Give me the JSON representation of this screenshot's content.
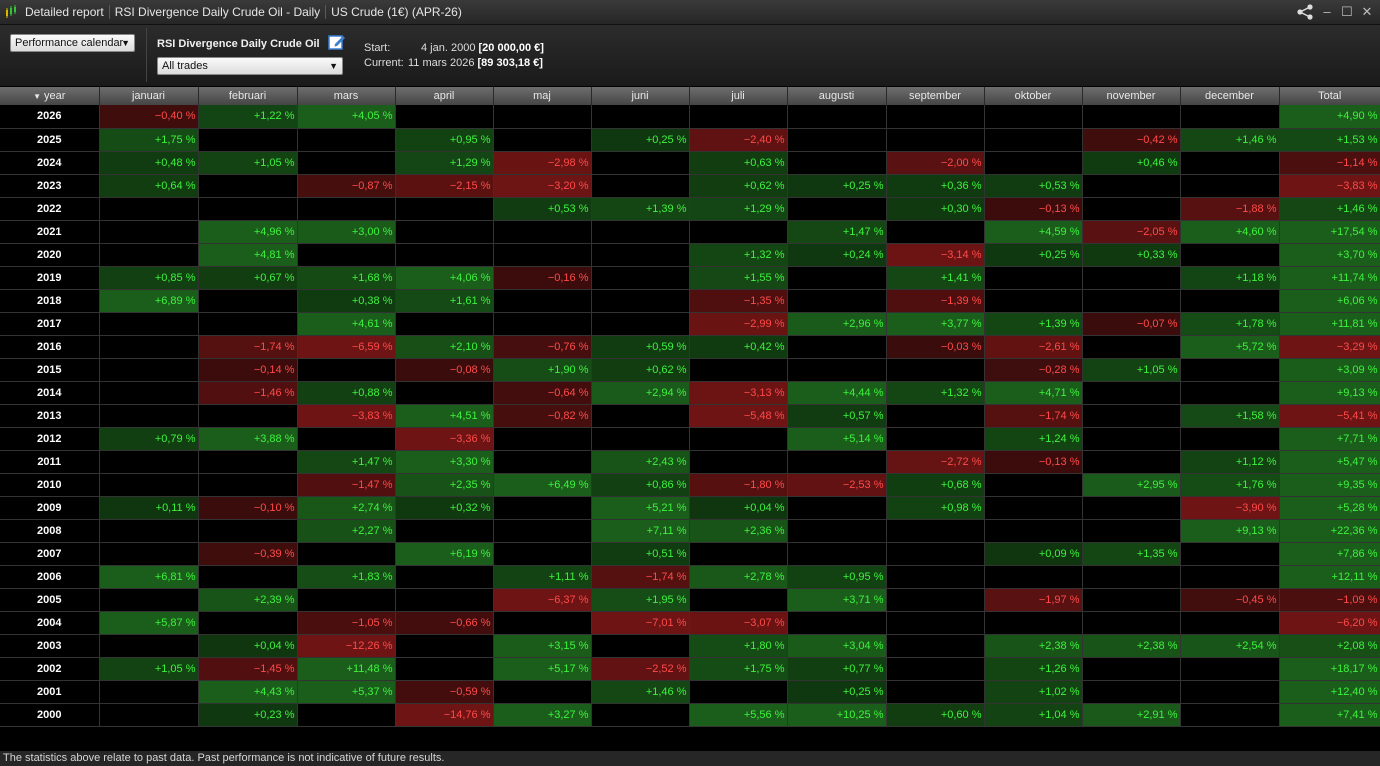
{
  "window": {
    "segments": [
      "Detailed report",
      "RSI Divergence Daily Crude Oil - Daily",
      "US Crude (1€) (APR-26)"
    ]
  },
  "controls": {
    "view_select": "Performance calendar",
    "strategy_name": "RSI Divergence Daily Crude Oil",
    "trades_select": "All trades",
    "start_label": "Start:",
    "start_date": "4 jan. 2000",
    "start_value": "[20 000,00 €]",
    "current_label": "Current:",
    "current_date": "11 mars 2026",
    "current_value": "[89 303,18 €]"
  },
  "table": {
    "sort_indicator": "▼",
    "columns": [
      "year",
      "januari",
      "februari",
      "mars",
      "april",
      "maj",
      "juni",
      "juli",
      "augusti",
      "september",
      "oktober",
      "november",
      "december",
      "Total"
    ],
    "rows": [
      [
        "2026",
        "−0,40 %",
        "+1,22 %",
        "+4,05 %",
        "",
        "",
        "",
        "",
        "",
        "",
        "",
        "",
        "",
        "+4,90 %"
      ],
      [
        "2025",
        "+1,75 %",
        "",
        "",
        "+0,95 %",
        "",
        "+0,25 %",
        "−2,40 %",
        "",
        "",
        "",
        "−0,42 %",
        "+1,46 %",
        "+1,53 %"
      ],
      [
        "2024",
        "+0,48 %",
        "+1,05 %",
        "",
        "+1,29 %",
        "−2,98 %",
        "",
        "+0,63 %",
        "",
        "−2,00 %",
        "",
        "+0,46 %",
        "",
        "−1,14 %"
      ],
      [
        "2023",
        "+0,64 %",
        "",
        "−0,87 %",
        "−2,15 %",
        "−3,20 %",
        "",
        "+0,62 %",
        "+0,25 %",
        "+0,36 %",
        "+0,53 %",
        "",
        "",
        "−3,83 %"
      ],
      [
        "2022",
        "",
        "",
        "",
        "",
        "+0,53 %",
        "+1,39 %",
        "+1,29 %",
        "",
        "+0,30 %",
        "−0,13 %",
        "",
        "−1,88 %",
        "+1,46 %"
      ],
      [
        "2021",
        "",
        "+4,96 %",
        "+3,00 %",
        "",
        "",
        "",
        "",
        "+1,47 %",
        "",
        "+4,59 %",
        "−2,05 %",
        "+4,60 %",
        "+17,54 %"
      ],
      [
        "2020",
        "",
        "+4,81 %",
        "",
        "",
        "",
        "",
        "+1,32 %",
        "+0,24 %",
        "−3,14 %",
        "+0,25 %",
        "+0,33 %",
        "",
        "+3,70 %"
      ],
      [
        "2019",
        "+0,85 %",
        "+0,67 %",
        "+1,68 %",
        "+4,06 %",
        "−0,16 %",
        "",
        "+1,55 %",
        "",
        "+1,41 %",
        "",
        "",
        "+1,18 %",
        "+11,74 %"
      ],
      [
        "2018",
        "+6,89 %",
        "",
        "+0,38 %",
        "+1,61 %",
        "",
        "",
        "−1,35 %",
        "",
        "−1,39 %",
        "",
        "",
        "",
        "+6,06 %"
      ],
      [
        "2017",
        "",
        "",
        "+4,61 %",
        "",
        "",
        "",
        "−2,99 %",
        "+2,96 %",
        "+3,77 %",
        "+1,39 %",
        "−0,07 %",
        "+1,78 %",
        "+11,81 %"
      ],
      [
        "2016",
        "",
        "−1,74 %",
        "−6,59 %",
        "+2,10 %",
        "−0,76 %",
        "+0,59 %",
        "+0,42 %",
        "",
        "−0,03 %",
        "−2,61 %",
        "",
        "+5,72 %",
        "−3,29 %"
      ],
      [
        "2015",
        "",
        "−0,14 %",
        "",
        "−0,08 %",
        "+1,90 %",
        "+0,62 %",
        "",
        "",
        "",
        "−0,28 %",
        "+1,05 %",
        "",
        "+3,09 %"
      ],
      [
        "2014",
        "",
        "−1,46 %",
        "+0,88 %",
        "",
        "−0,64 %",
        "+2,94 %",
        "−3,13 %",
        "+4,44 %",
        "+1,32 %",
        "+4,71 %",
        "",
        "",
        "+9,13 %"
      ],
      [
        "2013",
        "",
        "",
        "−3,83 %",
        "+4,51 %",
        "−0,82 %",
        "",
        "−5,48 %",
        "+0,57 %",
        "",
        "−1,74 %",
        "",
        "+1,58 %",
        "−5,41 %"
      ],
      [
        "2012",
        "+0,79 %",
        "+3,88 %",
        "",
        "−3,36 %",
        "",
        "",
        "",
        "+5,14 %",
        "",
        "+1,24 %",
        "",
        "",
        "+7,71 %"
      ],
      [
        "2011",
        "",
        "",
        "+1,47 %",
        "+3,30 %",
        "",
        "+2,43 %",
        "",
        "",
        "−2,72 %",
        "−0,13 %",
        "",
        "+1,12 %",
        "+5,47 %"
      ],
      [
        "2010",
        "",
        "",
        "−1,47 %",
        "+2,35 %",
        "+6,49 %",
        "+0,86 %",
        "−1,80 %",
        "−2,53 %",
        "+0,68 %",
        "",
        "+2,95 %",
        "+1,76 %",
        "+9,35 %"
      ],
      [
        "2009",
        "+0,11 %",
        "−0,10 %",
        "+2,74 %",
        "+0,32 %",
        "",
        "+5,21 %",
        "+0,04 %",
        "",
        "+0,98 %",
        "",
        "",
        "−3,90 %",
        "+5,28 %"
      ],
      [
        "2008",
        "",
        "",
        "+2,27 %",
        "",
        "",
        "+7,11 %",
        "+2,36 %",
        "",
        "",
        "",
        "",
        "+9,13 %",
        "+22,36 %"
      ],
      [
        "2007",
        "",
        "−0,39 %",
        "",
        "+6,19 %",
        "",
        "+0,51 %",
        "",
        "",
        "",
        "+0,09 %",
        "+1,35 %",
        "",
        "+7,86 %"
      ],
      [
        "2006",
        "+6,81 %",
        "",
        "+1,83 %",
        "",
        "+1,11 %",
        "−1,74 %",
        "+2,78 %",
        "+0,95 %",
        "",
        "",
        "",
        "",
        "+12,11 %"
      ],
      [
        "2005",
        "",
        "+2,39 %",
        "",
        "",
        "−6,37 %",
        "+1,95 %",
        "",
        "+3,71 %",
        "",
        "−1,97 %",
        "",
        "−0,45 %",
        "−1,09 %"
      ],
      [
        "2004",
        "+5,87 %",
        "",
        "−1,05 %",
        "−0,66 %",
        "",
        "−7,01 %",
        "−3,07 %",
        "",
        "",
        "",
        "",
        "",
        "−6,20 %"
      ],
      [
        "2003",
        "",
        "+0,04 %",
        "−12,26 %",
        "",
        "+3,15 %",
        "",
        "+1,80 %",
        "+3,04 %",
        "",
        "+2,38 %",
        "+2,38 %",
        "+2,54 %",
        "+2,08 %"
      ],
      [
        "2002",
        "+1,05 %",
        "−1,45 %",
        "+11,48 %",
        "",
        "+5,17 %",
        "−2,52 %",
        "+1,75 %",
        "+0,77 %",
        "",
        "+1,26 %",
        "",
        "",
        "+18,17 %"
      ],
      [
        "2001",
        "",
        "+4,43 %",
        "+5,37 %",
        "−0,59 %",
        "",
        "+1,46 %",
        "",
        "+0,25 %",
        "",
        "+1,02 %",
        "",
        "",
        "+12,40 %"
      ],
      [
        "2000",
        "",
        "+0,23 %",
        "",
        "−14,76 %",
        "+3,27 %",
        "",
        "+5,56 %",
        "+10,25 %",
        "+0,60 %",
        "+1,04 %",
        "+2,91 %",
        "",
        "+7,41 %"
      ]
    ]
  },
  "footer": {
    "disclaimer": "The statistics above relate to past data. Past performance is not indicative of future results."
  },
  "colors": {
    "positive_text": "#3df23d",
    "negative_text": "#ff4a4a",
    "positive_bg_strong": "#1b5e1b",
    "negative_bg_strong": "#6e1414"
  }
}
